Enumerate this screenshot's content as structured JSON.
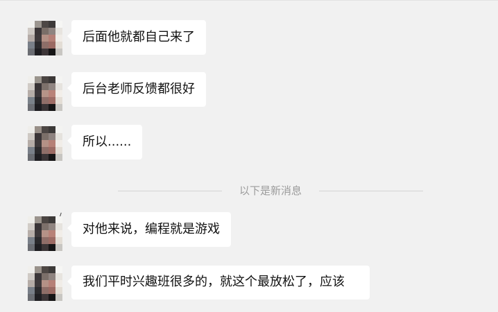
{
  "colors": {
    "background": "#f1f1f1",
    "bubble_bg": "#ffffff",
    "text": "#111111",
    "divider_text": "#9b9b9b",
    "divider_line": "#d3d3d3"
  },
  "messages": [
    {
      "text": "后面他就都自己来了",
      "avatar": "pixelated-avatar-icon"
    },
    {
      "text": "后台老师反馈都很好",
      "avatar": "pixelated-avatar-icon"
    },
    {
      "text": "所以......",
      "avatar": "pixelated-avatar-icon"
    },
    {
      "text": "对他来说，编程就是游戏",
      "avatar": "pixelated-avatar-icon"
    },
    {
      "text": "我们平时兴趣班很多的，就这个最放松了，应该",
      "avatar": "pixelated-avatar-icon"
    }
  ],
  "divider": {
    "text": "以下是新消息"
  }
}
